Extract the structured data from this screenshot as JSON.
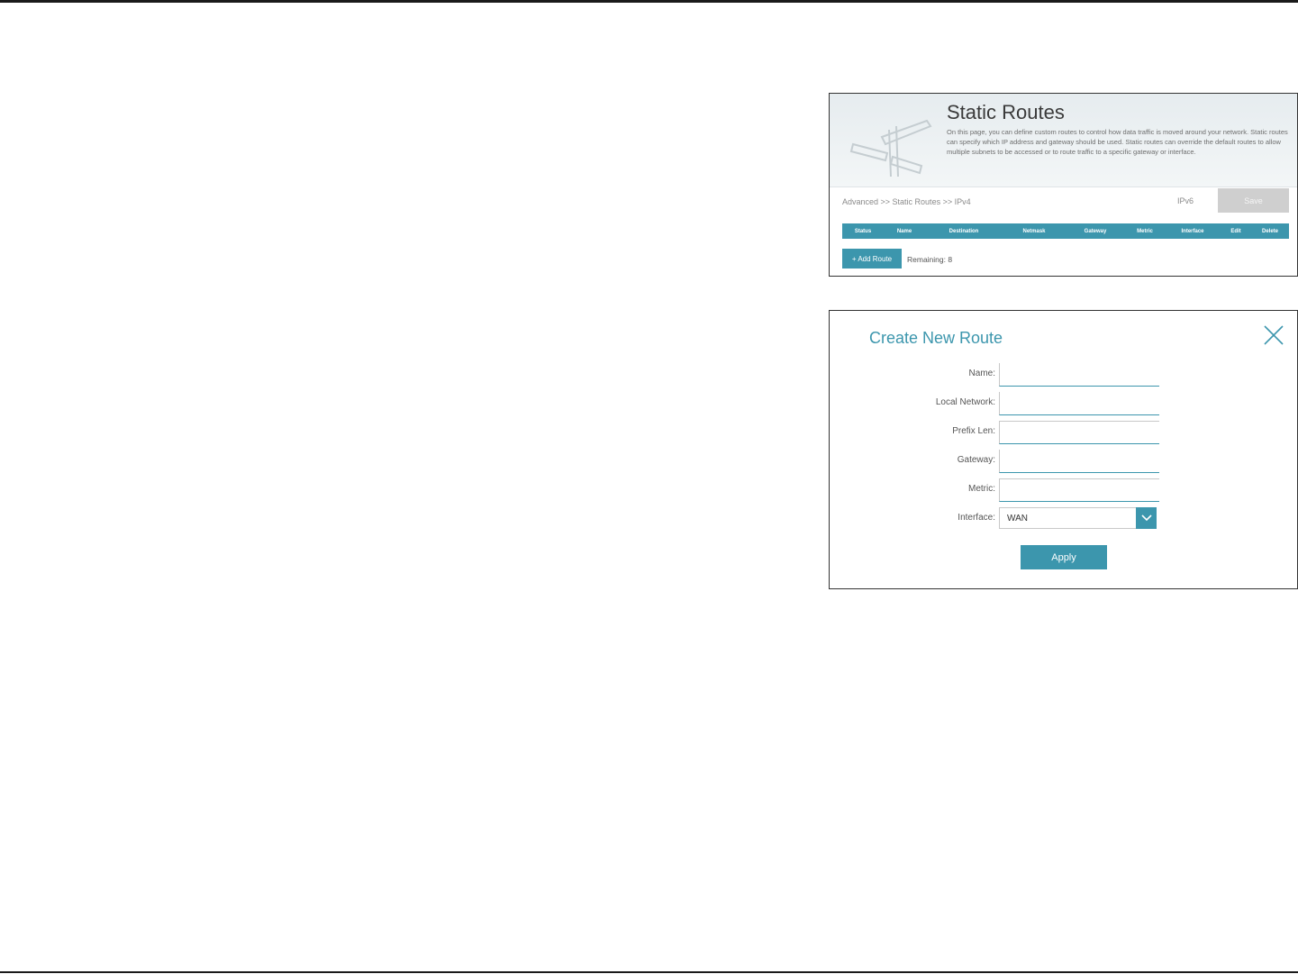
{
  "static_routes": {
    "title": "Static Routes",
    "description": "On this page, you can define custom routes to control how data traffic is moved around your network. Static routes can specify which IP address and gateway should be used. Static routes can override the default routes to allow multiple subnets to be accessed or to route traffic to a specific gateway or interface.",
    "breadcrumb": "Advanced >> Static Routes >> IPv4",
    "ipv6_link": "IPv6",
    "save_label": "Save",
    "columns": [
      "Status",
      "Name",
      "Destination",
      "Netmask",
      "Gateway",
      "Metric",
      "Interface",
      "Edit",
      "Delete"
    ],
    "add_route_label": "+ Add Route",
    "remaining_label": "Remaining: 8",
    "graphic_icon": "signpost-icon"
  },
  "create_route": {
    "title": "Create New Route",
    "close_icon": "close-icon",
    "fields": [
      {
        "label": "Name:",
        "value": ""
      },
      {
        "label": "Local Network:",
        "value": ""
      },
      {
        "label": "Prefix Len:",
        "value": ""
      },
      {
        "label": "Gateway:",
        "value": ""
      },
      {
        "label": "Metric:",
        "value": ""
      }
    ],
    "interface": {
      "label": "Interface:",
      "value": "WAN"
    },
    "apply_label": "Apply"
  },
  "colors": {
    "accent": "#3c96ad",
    "save_disabled": "#cfcfcf"
  }
}
